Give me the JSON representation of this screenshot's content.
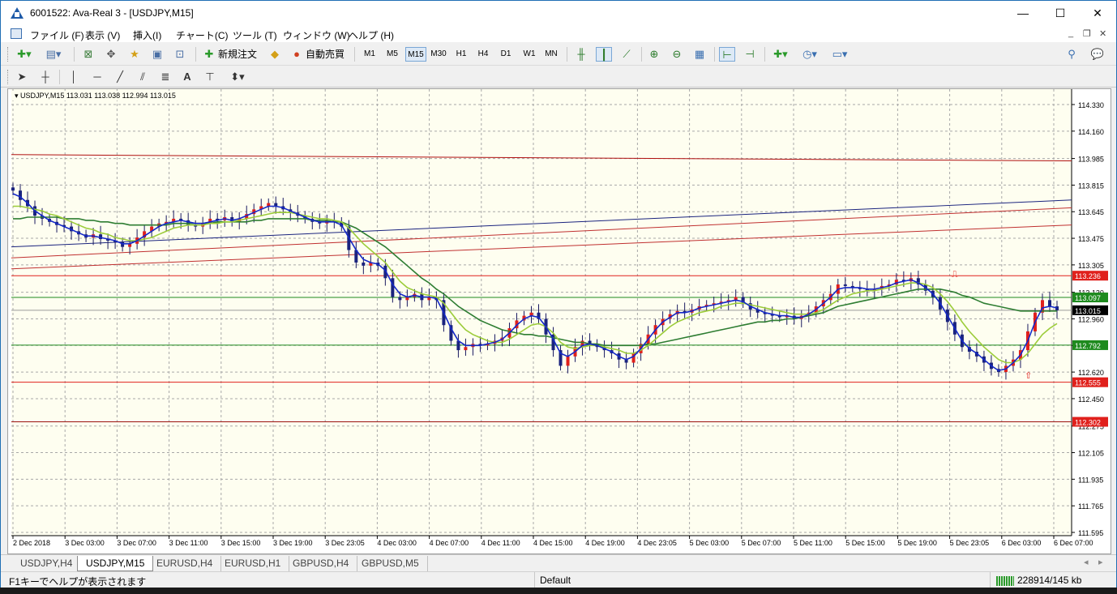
{
  "window": {
    "title": "6001522: Ava-Real 3 - [USDJPY,M15]",
    "minimize": "—",
    "maximize": "☐",
    "close": "✕"
  },
  "menu": {
    "items": [
      "ファイル (F)",
      "表示 (V)",
      "挿入(I)",
      "チャート(C)",
      "ツール (T)",
      "ウィンドウ (W)",
      "ヘルプ (H)"
    ],
    "mdi_minimize": "_",
    "mdi_restore": "❐",
    "mdi_close": "✕"
  },
  "toolbar": {
    "new_order": "新規注文",
    "auto_trading": "自動売買",
    "timeframes": [
      "M1",
      "M5",
      "M15",
      "M30",
      "H1",
      "H4",
      "D1",
      "W1",
      "MN"
    ],
    "active_timeframe": "M15",
    "icons": [
      "new-chart-icon",
      "profiles-icon",
      "market-watch-icon",
      "navigator-icon",
      "favorites-icon",
      "terminal-icon",
      "tester-icon",
      "new-order-icon",
      "metaeditor-icon",
      "auto-trading-icon",
      "bar-chart-icon",
      "candlestick-icon",
      "line-chart-icon",
      "zoom-in-icon",
      "zoom-out-icon",
      "tile-icon",
      "chart-shift-icon",
      "autoscroll-icon",
      "indicators-icon",
      "periods-icon",
      "templates-icon",
      "search-icon",
      "chat-icon"
    ]
  },
  "drawing_toolbar": {
    "text_tool": "A",
    "icons": [
      "cursor-icon",
      "crosshair-icon",
      "vertical-line-icon",
      "horizontal-line-icon",
      "trendline-icon",
      "equidistant-channel-icon",
      "fibonacci-icon",
      "text-icon",
      "text-label-icon",
      "arrows-icon"
    ]
  },
  "chart_data": {
    "type": "candlestick",
    "symbol_info": "USDJPY,M15  113.031 113.038 112.994 113.015",
    "y_ticks": [
      "114.330",
      "114.160",
      "113.985",
      "113.815",
      "113.645",
      "113.475",
      "113.305",
      "113.130",
      "112.960",
      "112.790",
      "112.620",
      "112.450",
      "112.275",
      "112.105",
      "111.935",
      "111.765",
      "111.595"
    ],
    "x_ticks": [
      "2 Dec 2018",
      "3 Dec 03:00",
      "3 Dec 07:00",
      "3 Dec 11:00",
      "3 Dec 15:00",
      "3 Dec 19:00",
      "3 Dec 23:05",
      "4 Dec 03:00",
      "4 Dec 07:00",
      "4 Dec 11:00",
      "4 Dec 15:00",
      "4 Dec 19:00",
      "4 Dec 23:05",
      "5 Dec 03:00",
      "5 Dec 07:00",
      "5 Dec 11:00",
      "5 Dec 15:00",
      "5 Dec 19:00",
      "5 Dec 23:05",
      "6 Dec 03:00",
      "6 Dec 07:00"
    ],
    "ylim": [
      111.595,
      114.33
    ],
    "grid": true,
    "price_labels": [
      {
        "text": "113.236",
        "value": 113.236,
        "color": "#e0201c"
      },
      {
        "text": "113.097",
        "value": 113.097,
        "color": "#1e8a1e"
      },
      {
        "text": "113.015",
        "value": 113.015,
        "color": "#000000"
      },
      {
        "text": "112.792",
        "value": 112.792,
        "color": "#1e8a1e"
      },
      {
        "text": "112.555",
        "value": 112.555,
        "color": "#e0201c"
      },
      {
        "text": "112.302",
        "value": 112.302,
        "color": "#e0201c"
      }
    ],
    "horizontal_lines": [
      {
        "value": 113.236,
        "color": "#e0201c"
      },
      {
        "value": 113.097,
        "color": "#1e8a1e"
      },
      {
        "value": 113.015,
        "color": "#9a9a9a"
      },
      {
        "value": 112.792,
        "color": "#1e8a1e"
      },
      {
        "value": 112.555,
        "color": "#e0201c"
      },
      {
        "value": 112.302,
        "color": "#9a1010"
      }
    ],
    "trend_lines": [
      {
        "from": [
          0,
          114.01
        ],
        "to": [
          1,
          113.97
        ],
        "color": "#b01010"
      },
      {
        "from": [
          0,
          113.42
        ],
        "to": [
          1,
          113.72
        ],
        "color": "#1a237e"
      },
      {
        "from": [
          0,
          113.35
        ],
        "to": [
          1,
          113.67
        ],
        "color": "#c03030"
      },
      {
        "from": [
          0,
          113.28
        ],
        "to": [
          1,
          113.56
        ],
        "color": "#c03030"
      }
    ],
    "close": [
      113.78,
      113.72,
      113.68,
      113.62,
      113.6,
      113.58,
      113.56,
      113.55,
      113.52,
      113.5,
      113.48,
      113.5,
      113.47,
      113.46,
      113.45,
      113.42,
      113.44,
      113.48,
      113.52,
      113.55,
      113.57,
      113.58,
      113.6,
      113.59,
      113.56,
      113.55,
      113.57,
      113.6,
      113.59,
      113.61,
      113.58,
      113.6,
      113.63,
      113.66,
      113.68,
      113.7,
      113.68,
      113.66,
      113.64,
      113.62,
      113.6,
      113.58,
      113.57,
      113.59,
      113.58,
      113.55,
      113.4,
      113.32,
      113.3,
      113.32,
      113.3,
      113.22,
      113.1,
      113.08,
      113.1,
      113.12,
      113.08,
      113.1,
      113.08,
      112.92,
      112.82,
      112.76,
      112.78,
      112.8,
      112.79,
      112.8,
      112.82,
      112.84,
      112.9,
      112.95,
      112.98,
      113.0,
      112.96,
      112.86,
      112.76,
      112.66,
      112.72,
      112.78,
      112.82,
      112.8,
      112.78,
      112.76,
      112.74,
      112.7,
      112.68,
      112.74,
      112.8,
      112.86,
      112.92,
      112.96,
      112.99,
      113.01,
      113.0,
      113.02,
      113.04,
      113.05,
      113.06,
      113.07,
      113.08,
      113.1,
      113.06,
      113.02,
      113.0,
      112.99,
      112.98,
      112.97,
      112.98,
      112.96,
      112.98,
      113.0,
      113.04,
      113.08,
      113.12,
      113.18,
      113.17,
      113.16,
      113.15,
      113.14,
      113.15,
      113.17,
      113.18,
      113.21,
      113.2,
      113.22,
      113.18,
      113.14,
      113.1,
      113.02,
      112.94,
      112.86,
      112.78,
      112.75,
      112.72,
      112.68,
      112.64,
      112.62,
      112.66,
      112.7,
      112.76,
      112.88,
      113.0,
      113.08,
      113.04,
      113.015
    ],
    "ma_fast": [
      113.76,
      113.74,
      113.7,
      113.65,
      113.62,
      113.59,
      113.57,
      113.55,
      113.53,
      113.51,
      113.49,
      113.49,
      113.48,
      113.47,
      113.46,
      113.44,
      113.44,
      113.46,
      113.49,
      113.52,
      113.55,
      113.57,
      113.58,
      113.59,
      113.58,
      113.57,
      113.57,
      113.58,
      113.59,
      113.6,
      113.59,
      113.6,
      113.62,
      113.64,
      113.66,
      113.68,
      113.68,
      113.67,
      113.65,
      113.63,
      113.61,
      113.59,
      113.58,
      113.58,
      113.58,
      113.56,
      113.48,
      113.4,
      113.34,
      113.32,
      113.31,
      113.27,
      113.18,
      113.12,
      113.1,
      113.11,
      113.1,
      113.1,
      113.09,
      113.0,
      112.9,
      112.82,
      112.79,
      112.79,
      112.79,
      112.8,
      112.81,
      112.83,
      112.87,
      112.92,
      112.96,
      112.98,
      112.97,
      112.91,
      112.83,
      112.74,
      112.72,
      112.75,
      112.79,
      112.8,
      112.79,
      112.77,
      112.75,
      112.72,
      112.7,
      112.72,
      112.77,
      112.83,
      112.89,
      112.94,
      112.97,
      113.0,
      113.0,
      113.01,
      113.03,
      113.04,
      113.05,
      113.06,
      113.07,
      113.08,
      113.07,
      113.04,
      113.02,
      113.0,
      112.99,
      112.98,
      112.98,
      112.97,
      112.97,
      112.99,
      113.02,
      113.06,
      113.1,
      113.15,
      113.16,
      113.16,
      113.16,
      113.15,
      113.15,
      113.16,
      113.17,
      113.19,
      113.2,
      113.21,
      113.19,
      113.16,
      113.12,
      113.06,
      112.98,
      112.9,
      112.82,
      112.77,
      112.74,
      112.7,
      112.66,
      112.63,
      112.64,
      112.68,
      112.73,
      112.82,
      112.94,
      113.03,
      113.04,
      113.03
    ],
    "ma_mid": [
      113.68,
      113.68,
      113.67,
      113.66,
      113.65,
      113.63,
      113.62,
      113.6,
      113.58,
      113.56,
      113.54,
      113.53,
      113.51,
      113.5,
      113.48,
      113.47,
      113.46,
      113.46,
      113.47,
      113.48,
      113.5,
      113.52,
      113.54,
      113.55,
      113.56,
      113.56,
      113.56,
      113.57,
      113.57,
      113.58,
      113.58,
      113.59,
      113.6,
      113.61,
      113.62,
      113.63,
      113.64,
      113.64,
      113.64,
      113.63,
      113.62,
      113.61,
      113.6,
      113.6,
      113.59,
      113.58,
      113.54,
      113.49,
      113.44,
      113.4,
      113.36,
      113.32,
      113.26,
      113.2,
      113.16,
      113.14,
      113.12,
      113.11,
      113.1,
      113.06,
      113.0,
      112.94,
      112.89,
      112.86,
      112.84,
      112.82,
      112.81,
      112.81,
      112.83,
      112.86,
      112.89,
      112.92,
      112.93,
      112.91,
      112.87,
      112.81,
      112.78,
      112.77,
      112.78,
      112.79,
      112.79,
      112.78,
      112.77,
      112.76,
      112.74,
      112.74,
      112.76,
      112.79,
      112.83,
      112.87,
      112.91,
      112.94,
      112.96,
      112.98,
      113.0,
      113.01,
      113.02,
      113.04,
      113.05,
      113.06,
      113.06,
      113.05,
      113.04,
      113.03,
      113.02,
      113.01,
      113.0,
      112.99,
      112.99,
      112.99,
      113.0,
      113.02,
      113.05,
      113.08,
      113.1,
      113.12,
      113.13,
      113.14,
      113.14,
      113.15,
      113.16,
      113.17,
      113.18,
      113.19,
      113.19,
      113.18,
      113.16,
      113.12,
      113.07,
      113.01,
      112.94,
      112.88,
      112.83,
      112.78,
      112.74,
      112.7,
      112.68,
      112.68,
      112.7,
      112.74,
      112.8,
      112.86,
      112.9,
      112.93
    ],
    "ma_slow": [
      113.6,
      113.6,
      113.61,
      113.61,
      113.61,
      113.61,
      113.61,
      113.6,
      113.6,
      113.6,
      113.59,
      113.59,
      113.58,
      113.58,
      113.57,
      113.57,
      113.56,
      113.56,
      113.56,
      113.56,
      113.56,
      113.56,
      113.57,
      113.57,
      113.57,
      113.57,
      113.57,
      113.57,
      113.58,
      113.58,
      113.58,
      113.58,
      113.58,
      113.59,
      113.59,
      113.6,
      113.6,
      113.6,
      113.6,
      113.6,
      113.6,
      113.59,
      113.59,
      113.59,
      113.58,
      113.58,
      113.56,
      113.54,
      113.51,
      113.48,
      113.45,
      113.42,
      113.38,
      113.34,
      113.3,
      113.26,
      113.22,
      113.19,
      113.15,
      113.12,
      113.08,
      113.04,
      113.01,
      112.98,
      112.95,
      112.93,
      112.91,
      112.89,
      112.88,
      112.87,
      112.86,
      112.86,
      112.85,
      112.85,
      112.84,
      112.83,
      112.82,
      112.81,
      112.81,
      112.8,
      112.8,
      112.79,
      112.79,
      112.79,
      112.79,
      112.79,
      112.79,
      112.8,
      112.8,
      112.81,
      112.82,
      112.83,
      112.84,
      112.85,
      112.86,
      112.87,
      112.88,
      112.89,
      112.9,
      112.91,
      112.92,
      112.93,
      112.94,
      112.94,
      112.95,
      112.95,
      112.96,
      112.96,
      112.97,
      112.98,
      112.99,
      113.0,
      113.02,
      113.04,
      113.05,
      113.06,
      113.07,
      113.08,
      113.09,
      113.1,
      113.11,
      113.12,
      113.13,
      113.14,
      113.15,
      113.15,
      113.15,
      113.15,
      113.14,
      113.13,
      113.11,
      113.1,
      113.08,
      113.06,
      113.05,
      113.04,
      113.03,
      113.02,
      113.01,
      113.01,
      113.01,
      113.01,
      113.01,
      113.01
    ]
  },
  "tabs": [
    "USDJPY,H4",
    "USDJPY,M15",
    "EURUSD,H4",
    "EURUSD,H1",
    "GBPUSD,H4",
    "GBPUSD,M5"
  ],
  "active_tab": "USDJPY,M15",
  "status": {
    "help": "F1キーでヘルプが表示されます",
    "profile": "Default",
    "traffic": "228914/145 kb"
  }
}
